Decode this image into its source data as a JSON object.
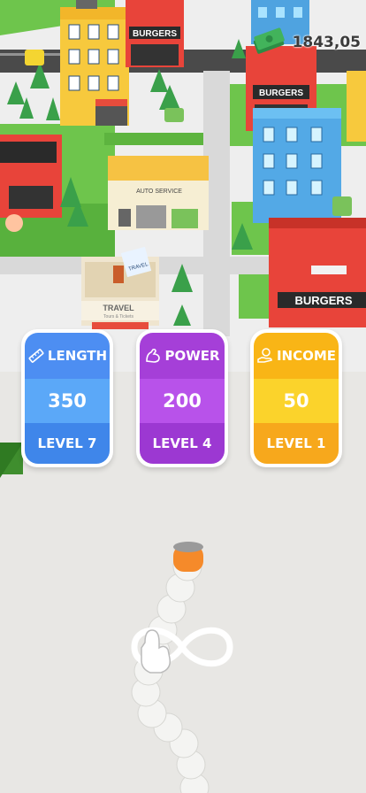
{
  "hud": {
    "money_value": "1843,05",
    "money_icon": "cash-stack-icon"
  },
  "city_signs": {
    "burgers_1": "BURGERS",
    "burgers_2": "BURGERS",
    "burgers_3": "BURGERS",
    "auto_service": "AUTO SERVICE",
    "travel_billboard": "TRAVEL",
    "travel_shop": "TRAVEL",
    "travel_sub": "Tours & Tickets"
  },
  "upgrades": [
    {
      "label": "LENGTH",
      "value": "350",
      "level": "LEVEL 7",
      "icon": "ruler-icon",
      "color": "#4d8ef2"
    },
    {
      "label": "POWER",
      "value": "200",
      "level": "LEVEL 4",
      "icon": "flexed-arm-icon",
      "color": "#a53fd8"
    },
    {
      "label": "INCOME",
      "value": "50",
      "level": "LEVEL 1",
      "icon": "hand-coin-icon",
      "color": "#f9b516"
    }
  ],
  "tutorial": {
    "gesture_icon": "infinity-swipe-hand-icon"
  }
}
